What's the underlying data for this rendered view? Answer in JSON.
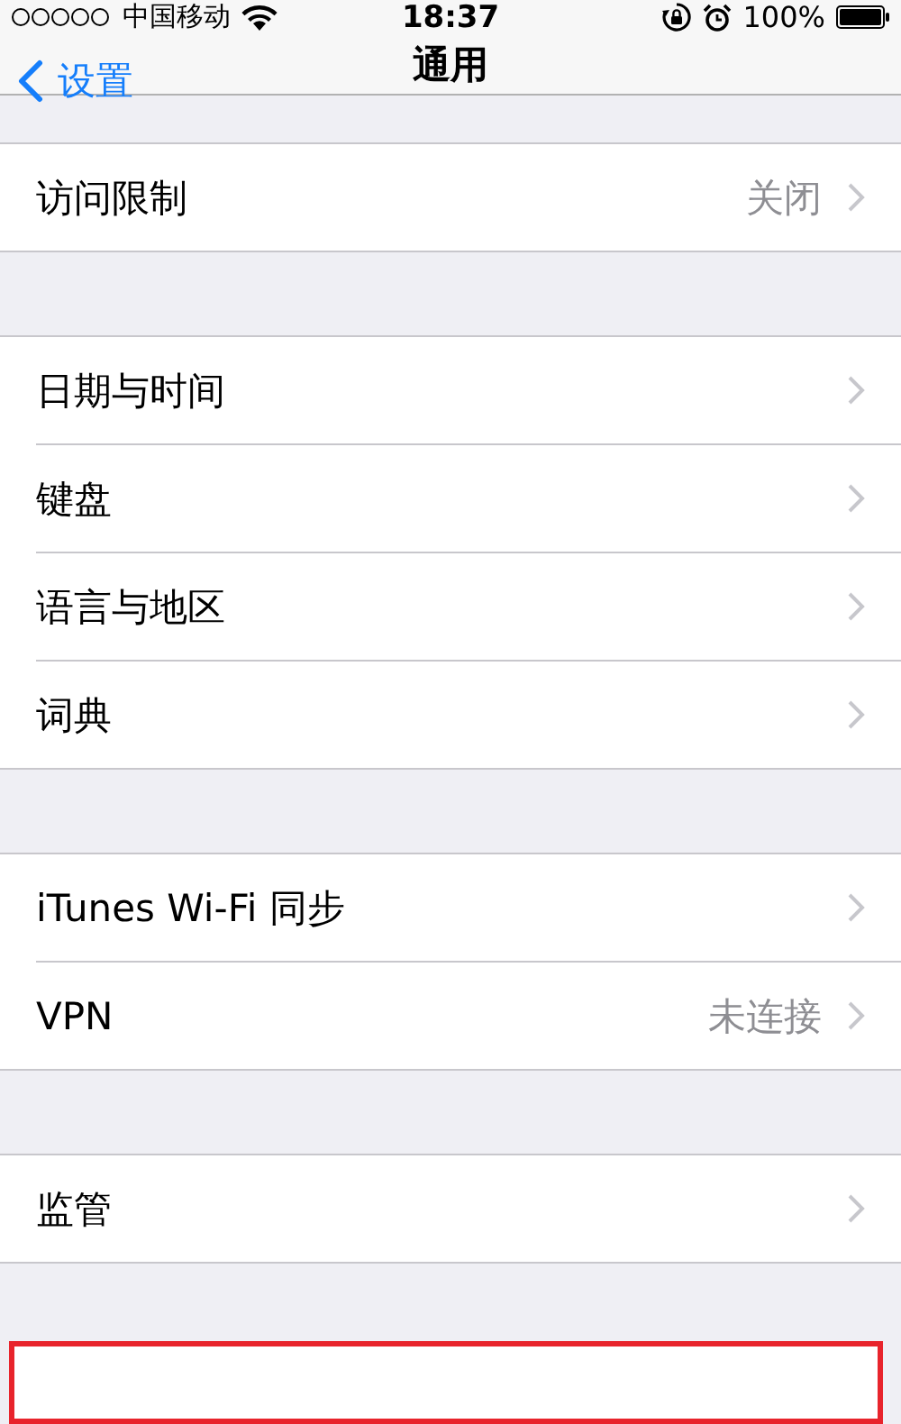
{
  "status_bar": {
    "carrier": "中国移动",
    "time": "18:37",
    "battery": "100%"
  },
  "nav_bar": {
    "back": "设置",
    "title": "通用"
  },
  "groups": [
    {
      "rows": [
        {
          "label": "访问限制",
          "value": "关闭"
        }
      ]
    },
    {
      "rows": [
        {
          "label": "日期与时间"
        },
        {
          "label": "键盘"
        },
        {
          "label": "语言与地区"
        },
        {
          "label": "词典"
        }
      ]
    },
    {
      "rows": [
        {
          "label": "iTunes Wi-Fi 同步"
        },
        {
          "label": "VPN",
          "value": "未连接"
        }
      ]
    },
    {
      "rows": [
        {
          "label": "监管"
        }
      ]
    }
  ]
}
